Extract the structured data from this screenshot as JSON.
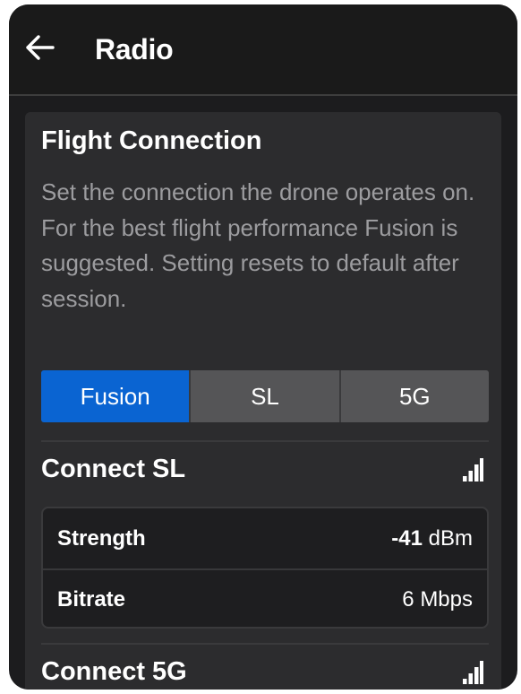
{
  "header": {
    "back_icon": "arrow-left-icon",
    "title": "Radio"
  },
  "flight_connection": {
    "title": "Flight Connection",
    "description": "Set the connection the drone operates on. For the best flight performance Fusion is suggested. Setting resets to default after session.",
    "options": [
      {
        "label": "Fusion",
        "selected": true
      },
      {
        "label": "SL",
        "selected": false
      },
      {
        "label": "5G",
        "selected": false
      }
    ],
    "accent_color": "#0a64d2"
  },
  "connect_sl": {
    "title": "Connect SL",
    "signal_icon": "signal-bars-icon",
    "strength": {
      "label": "Strength",
      "value": "-41",
      "unit": "dBm"
    },
    "bitrate": {
      "label": "Bitrate",
      "value": "6 Mbps"
    }
  },
  "connect_5g": {
    "title": "Connect 5G",
    "signal_icon": "signal-bars-icon"
  }
}
